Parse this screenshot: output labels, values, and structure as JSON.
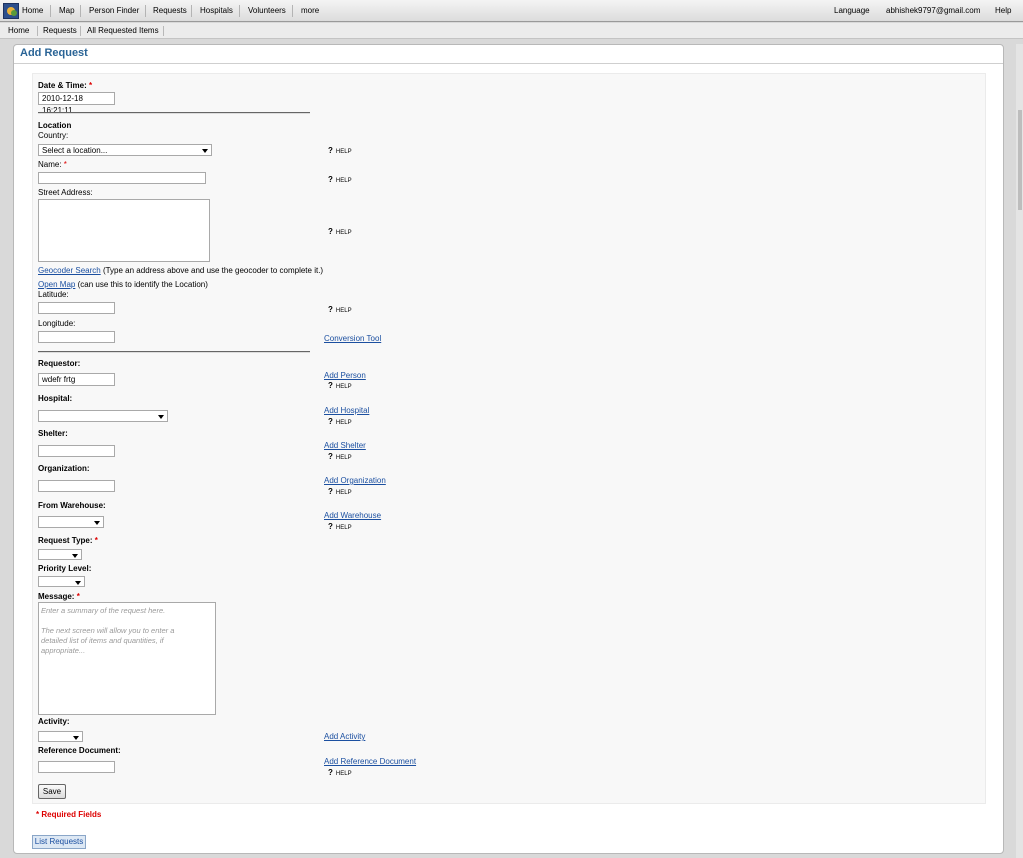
{
  "topnav": {
    "items": [
      "Home",
      "Map",
      "Person Finder",
      "Requests",
      "Hospitals",
      "Volunteers",
      "more"
    ],
    "language": "Language",
    "user": "abhishek9797@gmail.com",
    "help": "Help"
  },
  "subnav": {
    "items": [
      "Home",
      "Requests",
      "All Requested Items"
    ]
  },
  "panel": {
    "title": "Add Request"
  },
  "form": {
    "datetime": {
      "label": "Date & Time:",
      "required": "*",
      "value": "2010-12-18 16:21:11"
    },
    "location": {
      "heading": "Location",
      "country_label": "Country:",
      "country_value": "Select a location...",
      "name_label": "Name:",
      "name_required": "*",
      "street_label": "Street Address:",
      "geocoder_link": "Geocoder Search",
      "geocoder_text": "(Type an address above and use the geocoder to complete it.)",
      "openmap_link": "Open Map",
      "openmap_text": "(can use this to identify the Location)",
      "latitude_label": "Latitude:",
      "longitude_label": "Longitude:",
      "conversion_link": "Conversion Tool"
    },
    "help_text": "HELP",
    "help_mark": "?",
    "requestor": {
      "label": "Requestor:",
      "value": "wdefr frtg",
      "link": "Add Person"
    },
    "hospital": {
      "label": "Hospital:",
      "link": "Add Hospital"
    },
    "shelter": {
      "label": "Shelter:",
      "link": "Add Shelter"
    },
    "organization": {
      "label": "Organization:",
      "link": "Add Organization"
    },
    "warehouse": {
      "label": "From Warehouse:",
      "link": "Add Warehouse"
    },
    "request_type": {
      "label": "Request Type:",
      "required": "*"
    },
    "priority": {
      "label": "Priority Level:"
    },
    "message": {
      "label": "Message:",
      "required": "*",
      "placeholder1": "Enter a summary of the request here.",
      "placeholder2": "The next screen will allow you to enter a detailed list of items and quantities, if appropriate..."
    },
    "activity": {
      "label": "Activity:",
      "link": "Add Activity"
    },
    "refdoc": {
      "label": "Reference Document:",
      "link": "Add Reference Document"
    },
    "save_label": "Save",
    "required_note": "* Required Fields"
  },
  "list_requests": "List Requests"
}
